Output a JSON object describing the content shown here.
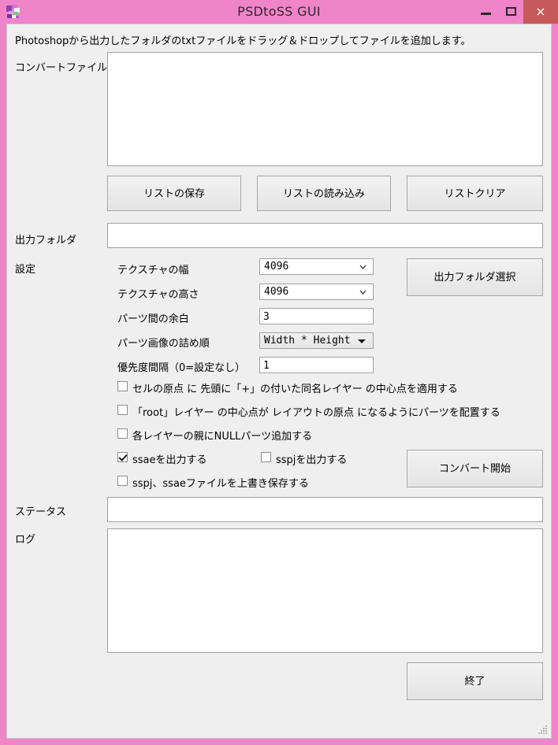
{
  "window": {
    "title": "PSDtoSS GUI",
    "accent_color": "#ef84c8",
    "close_button_color": "#c65a5a",
    "client_background": "#efefef",
    "app_icon": "psd-app-icon",
    "controls": {
      "minimize": "minimize-icon",
      "maximize": "maximize-icon",
      "close": "×"
    }
  },
  "instruction": "Photoshopから出力したフォルダのtxtファイルをドラッグ＆ドロップしてファイルを追加します。",
  "sections": {
    "convert_file_label": "コンバートファイル",
    "output_folder_label": "出力フォルダ",
    "settings_label": "設定",
    "status_label": "ステータス",
    "log_label": "ログ"
  },
  "file_list": {
    "items": [],
    "value": ""
  },
  "list_buttons": [
    {
      "label": "リストの保存",
      "name": "save-list-button"
    },
    {
      "label": "リストの読み込み",
      "name": "load-list-button"
    },
    {
      "label": "リストクリア",
      "name": "clear-list-button"
    }
  ],
  "output_folder": {
    "value": "",
    "select_button": "出力フォルダ選択"
  },
  "settings": {
    "texture_width": {
      "label": "テクスチャの幅",
      "value": "4096",
      "control": "combobox"
    },
    "texture_height": {
      "label": "テクスチャの高さ",
      "value": "4096",
      "control": "combobox"
    },
    "margin": {
      "label": "パーツ間の余白",
      "value": "3",
      "control": "textbox"
    },
    "pack_order": {
      "label": "パーツ画像の詰め順",
      "value": "Width * Height",
      "control": "dropdown"
    },
    "priority_interval": {
      "label": "優先度間隔（0=設定なし）",
      "value": "1",
      "control": "textbox"
    }
  },
  "checkboxes": [
    {
      "label": "セルの原点 に 先頭に「+」の付いた同名レイヤー の中心点を適用する",
      "checked": false,
      "name": "apply-plus-layer-center-checkbox"
    },
    {
      "label": "「root」レイヤー の中心点が レイアウトの原点 になるようにパーツを配置する",
      "checked": false,
      "name": "root-layer-origin-checkbox"
    },
    {
      "label": "各レイヤーの親にNULLパーツ追加する",
      "checked": false,
      "name": "add-null-parts-checkbox"
    },
    {
      "label": "ssaeを出力する",
      "checked": true,
      "name": "output-ssae-checkbox"
    },
    {
      "label": "sspjを出力する",
      "checked": false,
      "name": "output-sspj-checkbox"
    },
    {
      "label": "sspj、ssaeファイルを上書き保存する",
      "checked": false,
      "name": "overwrite-files-checkbox"
    }
  ],
  "actions": {
    "convert_button": "コンバート開始",
    "exit_button": "終了"
  },
  "status": {
    "value": ""
  },
  "log": {
    "value": ""
  }
}
